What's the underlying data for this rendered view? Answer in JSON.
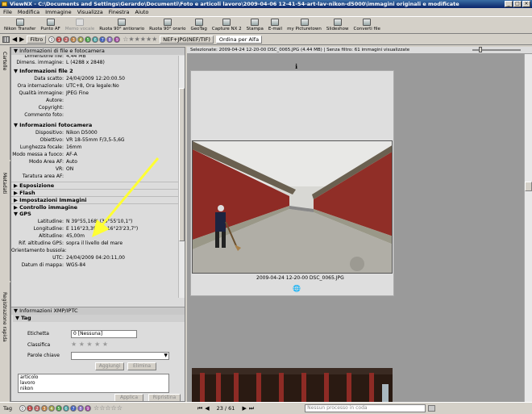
{
  "window": {
    "title": "ViewNX - C:\\Documents and Settings\\Gerardo\\Documenti\\Foto e articoli lavoro\\2009-04-06 12-41-54-art-lav-nikon-d5000\\immagini originali e modificate",
    "min": "_",
    "max": "□",
    "close": "×"
  },
  "menu": [
    "File",
    "Modifica",
    "Immagine",
    "Visualizza",
    "Finestra",
    "Aiuto"
  ],
  "toolbar": [
    {
      "label": "Nikon Transfer",
      "icon": "transfer-icon",
      "enabled": true
    },
    {
      "label": "Punto AF",
      "icon": "af-point-icon",
      "enabled": true
    },
    {
      "label": "Memo vocale",
      "icon": "voice-memo-icon",
      "enabled": false
    },
    {
      "label": "Ruota 90° antiorario",
      "icon": "rotate-ccw-icon",
      "enabled": true
    },
    {
      "label": "Ruota 90° orario",
      "icon": "rotate-cw-icon",
      "enabled": true
    },
    {
      "label": "GeoTag",
      "icon": "geotag-icon",
      "enabled": true
    },
    {
      "label": "Capture NX 2",
      "icon": "capture-nx-icon",
      "enabled": true
    },
    {
      "label": "Stampa",
      "icon": "print-icon",
      "enabled": true
    },
    {
      "label": "E-mail",
      "icon": "email-icon",
      "enabled": true
    },
    {
      "label": "my Picturetown",
      "icon": "picturetown-icon",
      "enabled": true
    },
    {
      "label": "Slideshow",
      "icon": "slideshow-icon",
      "enabled": true
    },
    {
      "label": "Converti file",
      "icon": "convert-icon",
      "enabled": true
    }
  ],
  "filterbar": {
    "filter_label": "Filtro",
    "labels": [
      "0",
      "1",
      "2",
      "3",
      "4",
      "5",
      "6",
      "7",
      "8",
      "9"
    ],
    "format_label": "NEF+JPG(NEF/TIF)",
    "sort_label": "Ordina per Alfa"
  },
  "label_colors": [
    "#ffffff",
    "#c04040",
    "#c06060",
    "#c08040",
    "#a0a040",
    "#40a040",
    "#40a0a0",
    "#4060c0",
    "#8060c0",
    "#a040a0"
  ],
  "side_tabs": {
    "folders": "Cartelle",
    "metadata": "Metadati",
    "tagging": "Registrazione rapida"
  },
  "file_info": {
    "header": "Informazioni di file e fotocamera",
    "partial_row": {
      "k": "Dimensione file:",
      "v": "4,44 MB"
    },
    "dim_row": {
      "k": "Dimens. immagine:",
      "v": "L (4288 x 2848)"
    },
    "file2_title": "Informazioni file 2",
    "file2_rows": [
      {
        "k": "Data scatto:",
        "v": "24/04/2009 12:20:00.50"
      },
      {
        "k": "Ora internazionale:",
        "v": "UTC+8, Ora legale:No"
      },
      {
        "k": "Qualità immagine:",
        "v": "JPEG Fine"
      },
      {
        "k": "Autore:",
        "v": ""
      },
      {
        "k": "Copyright:",
        "v": ""
      },
      {
        "k": "Commento foto:",
        "v": ""
      }
    ],
    "camera_title": "Informazioni fotocamera",
    "camera_rows": [
      {
        "k": "Dispositivo:",
        "v": "Nikon D5000"
      },
      {
        "k": "Obiettivo:",
        "v": "VR 18-55mm F/3,5-5,6G"
      },
      {
        "k": "Lunghezza focale:",
        "v": "16mm"
      },
      {
        "k": "Modo messa a fuoco:",
        "v": "AF-A"
      },
      {
        "k": "Modo Area AF:",
        "v": "Auto"
      },
      {
        "k": "VR:",
        "v": "ON"
      },
      {
        "k": "Taratura area AF:",
        "v": ""
      }
    ],
    "collapsed": [
      "Esposizione",
      "Flash",
      "Impostazioni Immagini",
      "Controllo immagine"
    ],
    "gps_title": "GPS",
    "gps_rows": [
      {
        "k": "Latitudine:",
        "v": "N 39°55,168' (39°55'10,1\")"
      },
      {
        "k": "Longitudine:",
        "v": "E 116°23,395' (116°23'23,7\")"
      },
      {
        "k": "Altitudine:",
        "v": "45,00m"
      },
      {
        "k": "Rif. altitudine GPS:",
        "v": "sopra il livello del mare"
      },
      {
        "k": "Orientamento bussola:",
        "v": ""
      },
      {
        "k": "UTC:",
        "v": "24/04/2009 04:20:11,00"
      },
      {
        "k": "Datum di mappa:",
        "v": "WGS-84"
      }
    ]
  },
  "xmp": {
    "title": "Informazioni XMP/IPTC",
    "tag_title": "Tag",
    "label_label": "Etichetta",
    "label_value": "0   [Nessuna]",
    "rating_label": "Classifica",
    "stars": "★ ★ ★ ★ ★",
    "keywords_label": "Parole chiave",
    "add_btn": "Aggiungi",
    "remove_btn": "Elimina",
    "keywords": [
      "articolo",
      "lavoro",
      "nikon"
    ],
    "apply_btn": "Applica",
    "restore_btn": "Ripristina"
  },
  "main": {
    "header": "Selezionate: 2009-04-24 12-20-00 DSC_0065.JPG (4.44 MB) | Senza filtro: 61 immagini visualizzate",
    "caption": "2009-04-24 12-20-00 DSC_0065.JPG",
    "info_glyph": "ℹ",
    "globe_glyph": "🌐"
  },
  "status": {
    "tag_label": "Tag",
    "counter": "23 / 61",
    "queue": "Nessun processo in coda"
  }
}
